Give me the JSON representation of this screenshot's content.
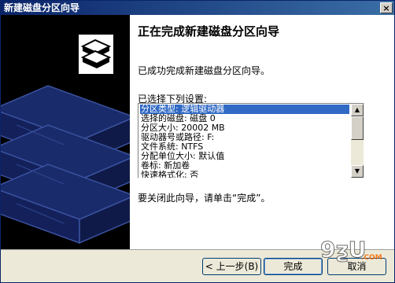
{
  "window": {
    "title": "新建磁盘分区向导",
    "close_glyph": "×"
  },
  "wizard": {
    "heading": "正在完成新建磁盘分区向导",
    "intro": "已成功完成新建磁盘分区向导。",
    "list_label": "已选择下列设置:",
    "settings": [
      "分区类型: 逻辑驱动器",
      "选择的磁盘: 磁盘 0",
      "分区大小: 20002 MB",
      "驱动器号或路径: F:",
      "文件系统: NTFS",
      "分配单位大小: 默认值",
      "卷标: 新加卷",
      "快速格式化: 否"
    ],
    "selected_index": 0,
    "close_hint": "要关闭此向导，请单击“完成”。"
  },
  "buttons": {
    "back": "< 上一步(B)",
    "finish": "完成",
    "cancel": "取消"
  },
  "scrollbar": {
    "up_glyph": "▲",
    "down_glyph": "▼"
  },
  "watermark": {
    "text": "9ƺU",
    "suffix": ".COM"
  },
  "colors": {
    "sidebar_bg": "#000000",
    "sidebar_panel": "#1a2b6b",
    "selection": "#316ac5"
  }
}
